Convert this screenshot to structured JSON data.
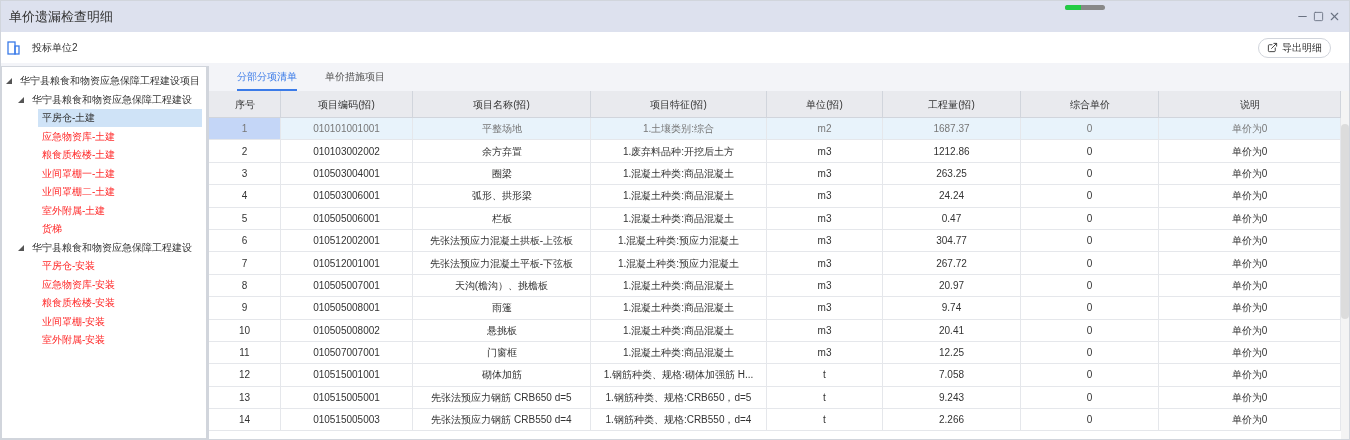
{
  "window": {
    "title": "单价遗漏检查明细"
  },
  "loading_bar": {
    "level": 0.4
  },
  "toolbar": {
    "unit": "投标单位2",
    "export_button": "导出明细"
  },
  "tree": [
    {
      "label": "华宁县粮食和物资应急保障工程建设项目",
      "expanded": true,
      "flagged": false,
      "selected": false,
      "children": [
        {
          "label": "华宁县粮食和物资应急保障工程建设",
          "expanded": true,
          "flagged": false,
          "selected": false,
          "children": [
            {
              "label": "平房仓-土建",
              "flagged": false,
              "selected": true
            },
            {
              "label": "应急物资库-土建",
              "flagged": true,
              "selected": false
            },
            {
              "label": "粮食质检楼-土建",
              "flagged": true,
              "selected": false
            },
            {
              "label": "业间罩棚一-土建",
              "flagged": true,
              "selected": false
            },
            {
              "label": "业间罩棚二-土建",
              "flagged": true,
              "selected": false
            },
            {
              "label": "室外附属-土建",
              "flagged": true,
              "selected": false
            },
            {
              "label": "货梯",
              "flagged": true,
              "selected": false
            }
          ]
        },
        {
          "label": "华宁县粮食和物资应急保障工程建设",
          "expanded": true,
          "flagged": false,
          "selected": false,
          "children": [
            {
              "label": "平房仓-安装",
              "flagged": true,
              "selected": false
            },
            {
              "label": "应急物资库-安装",
              "flagged": true,
              "selected": false
            },
            {
              "label": "粮食质检楼-安装",
              "flagged": true,
              "selected": false
            },
            {
              "label": "业间罩棚-安装",
              "flagged": true,
              "selected": false
            },
            {
              "label": "室外附属-安装",
              "flagged": true,
              "selected": false
            }
          ]
        }
      ]
    }
  ],
  "tabs": [
    {
      "label": "分部分项清单",
      "selected": true
    },
    {
      "label": "单价措施项目",
      "selected": false
    }
  ],
  "table": {
    "columns": [
      "序号",
      "项目编码(招)",
      "项目名称(招)",
      "项目特征(招)",
      "单位(招)",
      "工程量(招)",
      "综合单价",
      "说明"
    ],
    "rows": [
      {
        "selected": true,
        "cells": [
          "1",
          "010101001001",
          "平整场地",
          "1.土壤类别:综合",
          "m2",
          "1687.37",
          "0",
          "单价为0"
        ]
      },
      {
        "selected": false,
        "cells": [
          "2",
          "010103002002",
          "余方弃置",
          "1.废弃料品种:开挖后土方",
          "m3",
          "1212.86",
          "0",
          "单价为0"
        ]
      },
      {
        "selected": false,
        "cells": [
          "3",
          "010503004001",
          "圈梁",
          "1.混凝土种类:商品混凝土",
          "m3",
          "263.25",
          "0",
          "单价为0"
        ]
      },
      {
        "selected": false,
        "cells": [
          "4",
          "010503006001",
          "弧形、拱形梁",
          "1.混凝土种类:商品混凝土",
          "m3",
          "24.24",
          "0",
          "单价为0"
        ]
      },
      {
        "selected": false,
        "cells": [
          "5",
          "010505006001",
          "栏板",
          "1.混凝土种类:商品混凝土",
          "m3",
          "0.47",
          "0",
          "单价为0"
        ]
      },
      {
        "selected": false,
        "cells": [
          "6",
          "010512002001",
          "先张法预应力混凝土拱板-上弦板",
          "1.混凝土种类:预应力混凝土",
          "m3",
          "304.77",
          "0",
          "单价为0"
        ]
      },
      {
        "selected": false,
        "cells": [
          "7",
          "010512001001",
          "先张法预应力混凝土平板-下弦板",
          "1.混凝土种类:预应力混凝土",
          "m3",
          "267.72",
          "0",
          "单价为0"
        ]
      },
      {
        "selected": false,
        "cells": [
          "8",
          "010505007001",
          "天沟(檐沟）、挑檐板",
          "1.混凝土种类:商品混凝土",
          "m3",
          "20.97",
          "0",
          "单价为0"
        ]
      },
      {
        "selected": false,
        "cells": [
          "9",
          "010505008001",
          "雨篷",
          "1.混凝土种类:商品混凝土",
          "m3",
          "9.74",
          "0",
          "单价为0"
        ]
      },
      {
        "selected": false,
        "cells": [
          "10",
          "010505008002",
          "悬挑板",
          "1.混凝土种类:商品混凝土",
          "m3",
          "20.41",
          "0",
          "单价为0"
        ]
      },
      {
        "selected": false,
        "cells": [
          "11",
          "010507007001",
          "门窗框",
          "1.混凝土种类:商品混凝土",
          "m3",
          "12.25",
          "0",
          "单价为0"
        ]
      },
      {
        "selected": false,
        "cells": [
          "12",
          "010515001001",
          "砌体加筋",
          "1.钢筋种类、规格:砌体加强筋 H...",
          "t",
          "7.058",
          "0",
          "单价为0"
        ]
      },
      {
        "selected": false,
        "cells": [
          "13",
          "010515005001",
          "先张法预应力钢筋 CRB650 d=5",
          "1.钢筋种类、规格:CRB650，d=5",
          "t",
          "9.243",
          "0",
          "单价为0"
        ]
      },
      {
        "selected": false,
        "cells": [
          "14",
          "010515005003",
          "先张法预应力钢筋 CRB550 d=4",
          "1.钢筋种类、规格:CRB550，d=4",
          "t",
          "2.266",
          "0",
          "单价为0"
        ]
      }
    ]
  }
}
